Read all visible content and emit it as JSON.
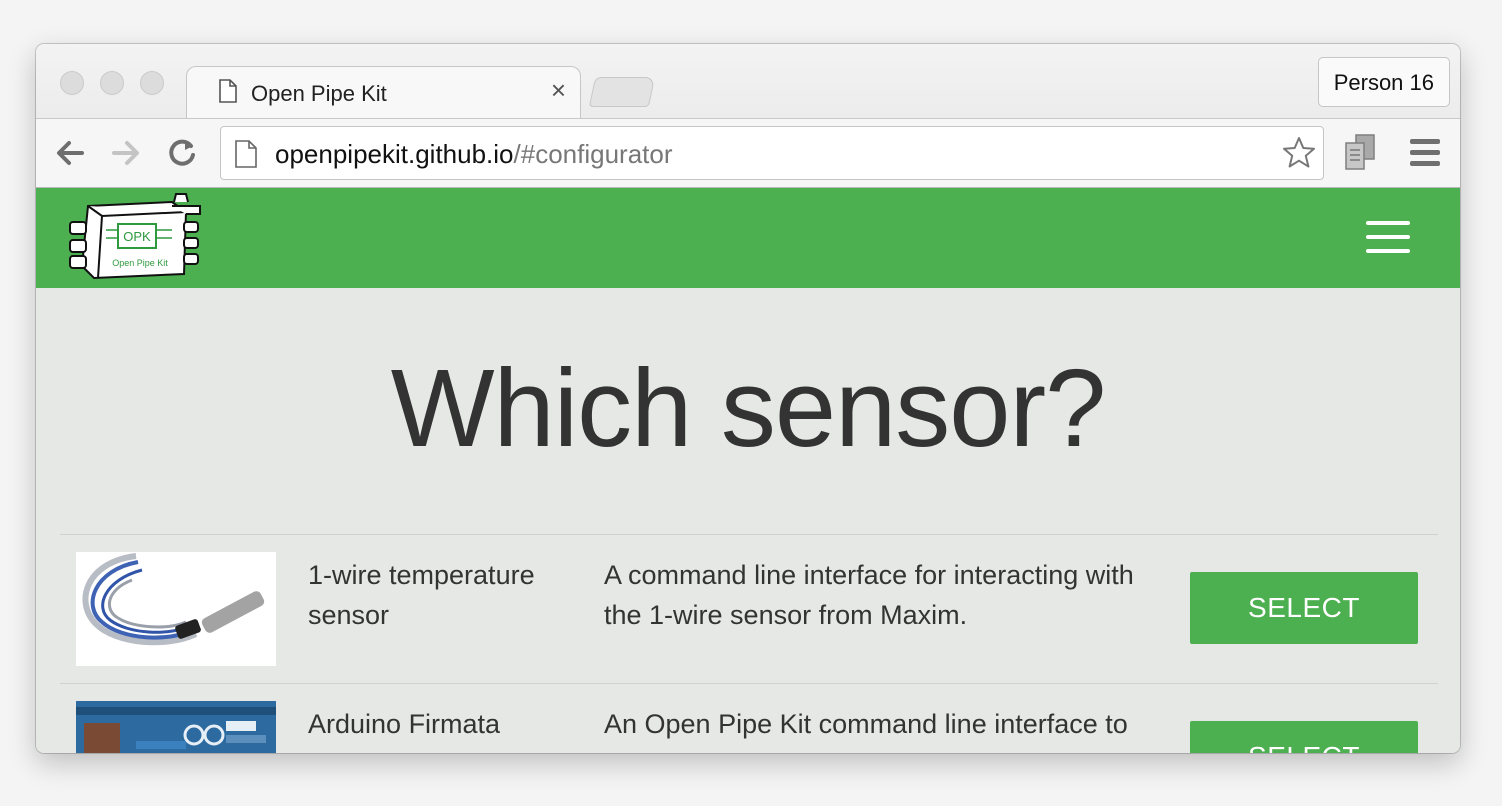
{
  "browser": {
    "tab_title": "Open Pipe Kit",
    "tab_close": "×",
    "profile_label": "Person 16",
    "url_host": "openpipekit.github.io",
    "url_path": "/#configurator"
  },
  "header": {
    "logo_text": "OPK",
    "logo_subtext": "Open Pipe Kit",
    "brand_color": "#4caf50"
  },
  "main": {
    "heading": "Which sensor?",
    "sensors": [
      {
        "name": "1-wire temperature sensor",
        "description": "A command line interface for interacting with the 1-wire sensor from Maxim.",
        "button_label": "SELECT"
      },
      {
        "name": "Arduino Firmata adapter",
        "description": "An Open Pipe Kit command line interface to use Arduino using the Firmata firmware.",
        "button_label": "SELECT"
      }
    ]
  }
}
